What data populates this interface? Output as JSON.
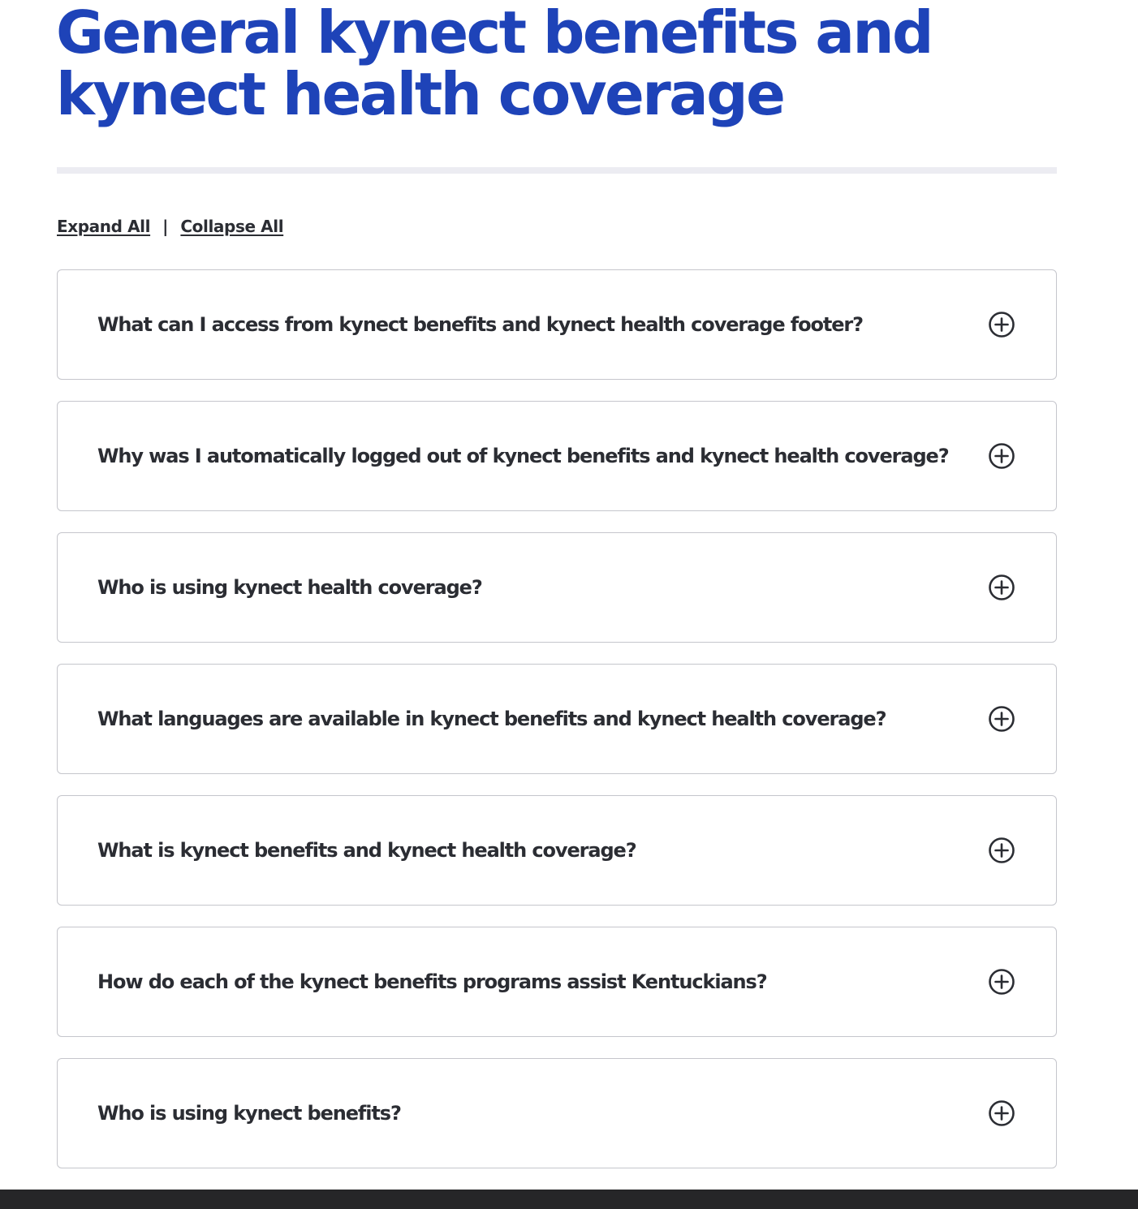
{
  "page": {
    "title": "General kynect benefits and kynect health coverage"
  },
  "controls": {
    "expand_all": "Expand All",
    "separator": "|",
    "collapse_all": "Collapse All"
  },
  "faq": [
    {
      "question": "What can I access from kynect benefits and kynect health coverage footer?",
      "expanded": false
    },
    {
      "question": "Why was I automatically logged out of kynect benefits and kynect health coverage?",
      "expanded": false
    },
    {
      "question": "Who is using kynect health coverage?",
      "expanded": false
    },
    {
      "question": "What languages are available in kynect benefits and kynect health coverage?",
      "expanded": false
    },
    {
      "question": "What is kynect benefits and kynect health coverage?",
      "expanded": false
    },
    {
      "question": "How do each of the kynect benefits programs assist Kentuckians?",
      "expanded": false
    },
    {
      "question": "Who is using kynect benefits?",
      "expanded": false
    }
  ],
  "icons": {
    "accordion_toggle": "plus-circle-icon"
  },
  "colors": {
    "title": "#1e43b8",
    "text": "#2b2d33",
    "border": "#c5c6cc",
    "divider": "#ececf2",
    "footer": "#262628"
  }
}
